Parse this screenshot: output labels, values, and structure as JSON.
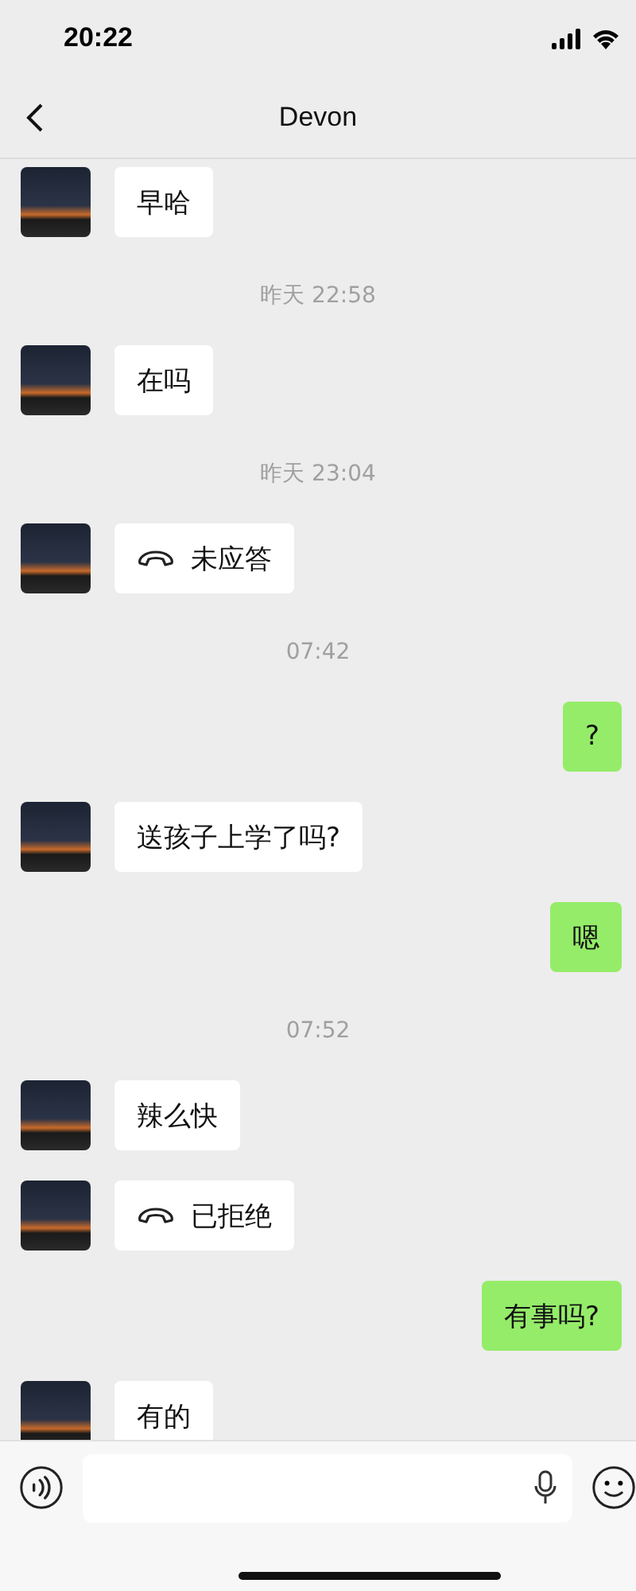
{
  "status_bar": {
    "time": "20:22"
  },
  "header": {
    "title": "Devon"
  },
  "messages": [
    {
      "kind": "text",
      "outgoing": false,
      "text": "早哈"
    },
    {
      "kind": "time",
      "text": "昨天 22:58"
    },
    {
      "kind": "text",
      "outgoing": false,
      "text": "在吗"
    },
    {
      "kind": "time",
      "text": "昨天 23:04"
    },
    {
      "kind": "call",
      "outgoing": false,
      "text": "未应答"
    },
    {
      "kind": "time",
      "text": "07:42"
    },
    {
      "kind": "text",
      "outgoing": true,
      "text": "?"
    },
    {
      "kind": "text",
      "outgoing": false,
      "text": "送孩子上学了吗?"
    },
    {
      "kind": "text",
      "outgoing": true,
      "text": "嗯"
    },
    {
      "kind": "time",
      "text": "07:52"
    },
    {
      "kind": "text",
      "outgoing": false,
      "text": "辣么快"
    },
    {
      "kind": "call",
      "outgoing": false,
      "text": "已拒绝"
    },
    {
      "kind": "text",
      "outgoing": true,
      "text": "有事吗?"
    },
    {
      "kind": "text",
      "outgoing": false,
      "text": "有的"
    }
  ]
}
